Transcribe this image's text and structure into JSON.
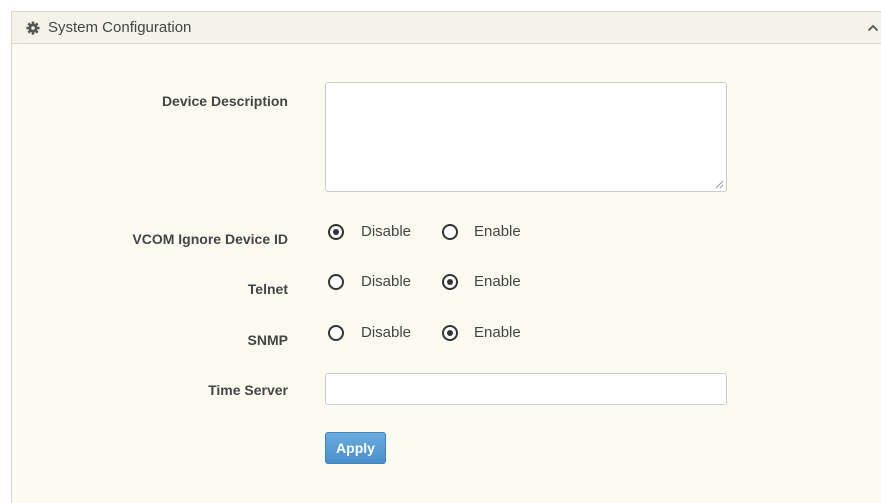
{
  "panel": {
    "title": "System Configuration",
    "title_icon": "gear-icon",
    "collapse_icon": "chevron-up-icon"
  },
  "form": {
    "device_description": {
      "label": "Device Description",
      "value": ""
    },
    "vcom_ignore_device_id": {
      "label": "VCOM Ignore Device ID",
      "options": [
        "Disable",
        "Enable"
      ],
      "selected": "Disable"
    },
    "telnet": {
      "label": "Telnet",
      "options": [
        "Disable",
        "Enable"
      ],
      "selected": "Enable"
    },
    "snmp": {
      "label": "SNMP",
      "options": [
        "Disable",
        "Enable"
      ],
      "selected": "Enable"
    },
    "time_server": {
      "label": "Time Server",
      "value": ""
    },
    "apply_label": "Apply"
  },
  "colors": {
    "panel_background": "#fcfbf2",
    "header_background": "#f4f3ea",
    "apply_button": "#5a9dd6"
  }
}
